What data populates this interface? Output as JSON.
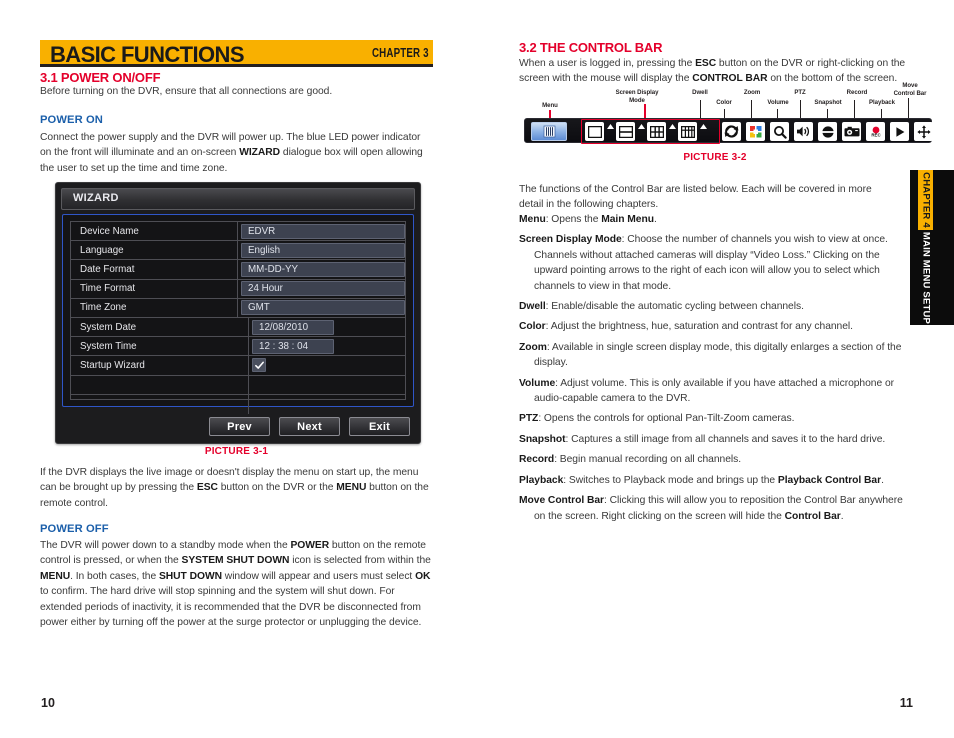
{
  "left_page": {
    "chapter_banner": {
      "title": "BASIC FUNCTIONS",
      "chapter": "CHAPTER 3"
    },
    "section_heading": "3.1 POWER ON/OFF",
    "intro": "Before turning on the DVR, ensure that all connections are good.",
    "power_on": {
      "heading": "POWER ON",
      "text_1": "Connect the power supply and the DVR will power up. The blue LED power indicator on the front will illuminate and an on-screen ",
      "bold_1": "WIZARD",
      "text_2": " dialogue box will open allowing the user to set up the time and time zone."
    },
    "picture_label": "PICTURE 3-1",
    "after_picture": {
      "t1": "If the DVR displays the live image or doesn't display the menu on start up, the menu can be brought up by pressing the ",
      "b1": "ESC",
      "t2": " button on the DVR or the ",
      "b2": "MENU",
      "t3": " button on the remote control."
    },
    "power_off": {
      "heading": "POWER OFF",
      "t1": "The DVR will power down to a standby mode when the ",
      "b1": "POWER",
      "t2": " button on the remote control is pressed, or when the ",
      "b2": "SYSTEM SHUT DOWN",
      "t3": " icon is selected from within the ",
      "b3": "MENU",
      "t4": ". In both cases, the ",
      "b4": "SHUT DOWN",
      "t5": " window will appear and users must select ",
      "b5": "OK",
      "t6": " to confirm. The hard drive will stop spinning and the system will shut down. For extended periods of inactivity, it is recommended that the DVR be disconnected from power either by turning off the power at the surge protector or unplugging the device."
    },
    "folio": "10"
  },
  "wizard": {
    "title": "WIZARD",
    "rows": [
      {
        "label": "Device Name",
        "value": "EDVR",
        "value_type": "full"
      },
      {
        "label": "Language",
        "value": "English",
        "value_type": "full"
      },
      {
        "label": "Date Format",
        "value": "MM-DD-YY",
        "value_type": "full"
      },
      {
        "label": "Time Format",
        "value": "24 Hour",
        "value_type": "full"
      },
      {
        "label": "Time Zone",
        "value": "GMT",
        "value_type": "full"
      },
      {
        "label": "System Date",
        "value": "12/08/2010",
        "value_type": "mid"
      },
      {
        "label": "System Time",
        "value": "12 : 38 : 04",
        "value_type": "mid"
      },
      {
        "label": "Startup Wizard",
        "value": "",
        "value_type": "checkbox",
        "checked": true
      },
      {
        "label": "",
        "value": "",
        "value_type": "none"
      },
      {
        "label": "",
        "value": "",
        "value_type": "none"
      }
    ],
    "buttons": [
      {
        "label": "Prev"
      },
      {
        "label": "Next"
      },
      {
        "label": "Exit"
      }
    ],
    "accent_border": "#2f56c8"
  },
  "right_page": {
    "section_heading": "3.2 THE CONTROL BAR",
    "intro": {
      "t1": "When a user is logged in, pressing the ",
      "b1": "ESC",
      "t2": " button on the DVR or right-clicking on the screen with the mouse will display the ",
      "b2": "CONTROL BAR",
      "t3": " on the bottom of the screen."
    },
    "picture_label": "PICTURE 3-2",
    "lead_in": "The functions of the Control Bar are listed below. Each will be covered in more detail in the following chapters.",
    "definitions": [
      {
        "term": "Menu",
        "t1": ": Opens the ",
        "b1": "Main Menu",
        "t2": "."
      },
      {
        "term": "Screen Display Mode",
        "t1": ": Choose the number of channels you wish to view at once. Channels without attached cameras will display “Video Loss.” Clicking on the upward pointing arrows to the right of each icon will allow you to select which channels to view in that mode."
      },
      {
        "term": "Dwell",
        "t1": ": Enable/disable the automatic cycling between channels."
      },
      {
        "term": "Color",
        "t1": ": Adjust the brightness, hue, saturation and contrast for any channel."
      },
      {
        "term": "Zoom",
        "t1": ": Available in single screen display mode, this digitally enlarges a section of the display."
      },
      {
        "term": "Volume",
        "t1": ": Adjust volume. This is only available if you have attached a microphone or audio-capable camera to the DVR."
      },
      {
        "term": "PTZ",
        "t1": ": Opens the controls for optional Pan-Tilt-Zoom cameras."
      },
      {
        "term": "Snapshot",
        "t1": ": Captures a still image from all channels and saves it to the hard drive."
      },
      {
        "term": "Record",
        "t1": ": Begin manual recording on all channels."
      },
      {
        "term": "Playback",
        "t1": ": Switches to Playback mode and brings up the ",
        "b1": "Playback Control Bar",
        "t2": "."
      },
      {
        "term": "Move Control Bar",
        "t1": ": Clicking this will allow you to reposition the Control Bar anywhere on the screen. Right clicking on the screen will hide the ",
        "b1": "Control Bar",
        "t2": "."
      }
    ],
    "folio": "11"
  },
  "control_bar": {
    "callouts": [
      {
        "label": "Menu",
        "icon": "menu-icon"
      },
      {
        "label": "Screen Display\nMode",
        "icon": "screen-display-mode-icons"
      },
      {
        "label": "Dwell",
        "icon": "dwell-icon"
      },
      {
        "label": "Color",
        "icon": "color-icon"
      },
      {
        "label": "Zoom",
        "icon": "zoom-icon"
      },
      {
        "label": "Volume",
        "icon": "volume-icon"
      },
      {
        "label": "PTZ",
        "icon": "ptz-icon"
      },
      {
        "label": "Snapshot",
        "icon": "snapshot-icon"
      },
      {
        "label": "Record",
        "icon": "record-icon"
      },
      {
        "label": "Playback",
        "icon": "playback-icon"
      },
      {
        "label": "Move\nControl Bar",
        "icon": "move-control-bar-icon"
      }
    ],
    "record_icon_text": "REC",
    "highlight_color": "#e4002b"
  },
  "chapter_tab": {
    "number_label": "CHAPTER 4",
    "name_label": "MAIN MENU SETUP",
    "accent": "#f9b000"
  }
}
